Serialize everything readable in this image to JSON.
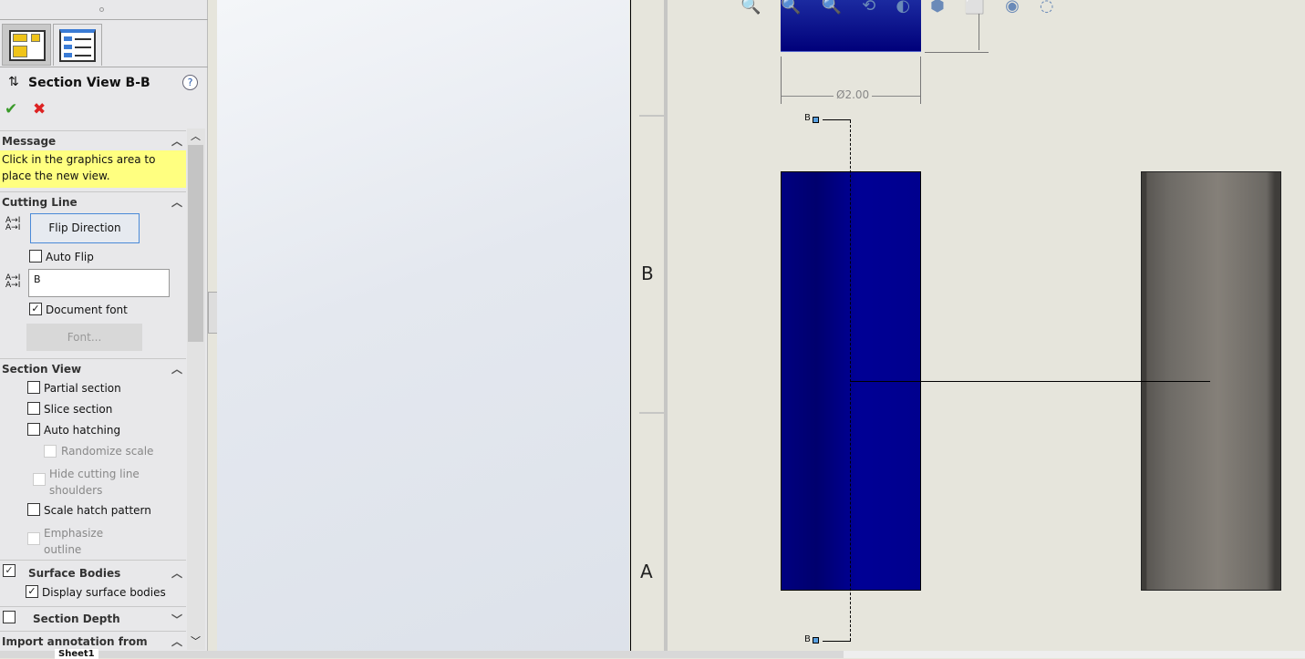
{
  "panel": {
    "title": "Section View B-B",
    "help": "?",
    "ok": "✔",
    "cancel": "✖",
    "message": {
      "header": "Message",
      "text": "Click in the graphics area to place the new view."
    },
    "cutting_line": {
      "header": "Cutting Line",
      "flip": "Flip Direction",
      "auto_flip": "Auto Flip",
      "label_value": "B",
      "document_font": "Document font",
      "font_button": "Font..."
    },
    "section_view": {
      "header": "Section View",
      "partial": "Partial section",
      "slice": "Slice section",
      "auto_hatch": "Auto hatching",
      "randomize": "Randomize scale",
      "hide_cut": "Hide cutting line shoulders",
      "scale_hatch": "Scale hatch pattern",
      "emphasize": "Emphasize outline"
    },
    "surface_bodies": {
      "header": "Surface Bodies",
      "display": "Display surface bodies"
    },
    "section_depth": {
      "header": "Section Depth"
    },
    "import_annotation": {
      "header": "Import annotation from"
    }
  },
  "drawing": {
    "dimension": "Ø2.00",
    "zone_b": "B",
    "zone_a": "A",
    "cut_label_top": "B",
    "cut_label_bottom": "B",
    "colors": {
      "part": "#00008e",
      "section": "#6e6b66"
    }
  },
  "sheet_tab": "Sheet1"
}
